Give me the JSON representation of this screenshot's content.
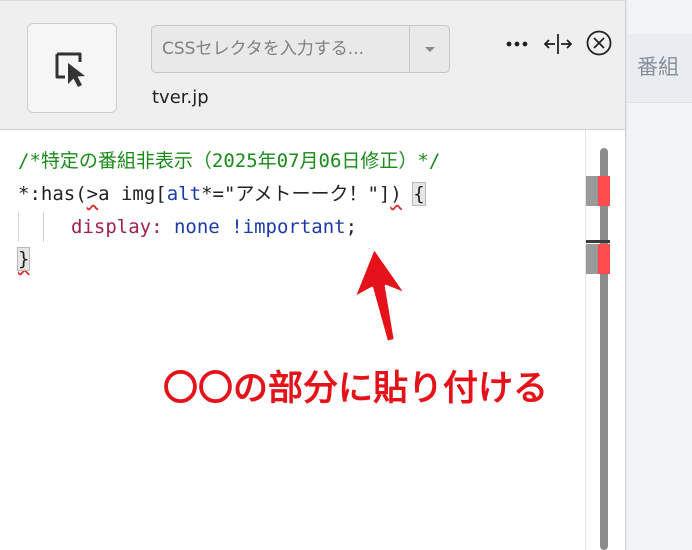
{
  "toolbar": {
    "selector_placeholder": "CSSセレクタを入力する...",
    "host": "tver.jp",
    "icons": {
      "picker": "element-picker-icon",
      "dropdown": "chevron-down-icon",
      "more": "more-dots-icon",
      "resize": "resize-horizontal-icon",
      "close": "close-circle-icon"
    }
  },
  "background_page": {
    "tab_label": "番組"
  },
  "editor": {
    "line1": "/*特定の番組非表示（2025年07月06日修正）*/",
    "line2": {
      "sel_start": "*:has(",
      "combinator": ">",
      "sel_mid": "a img[",
      "attr": "alt",
      "op": "*=",
      "str": "\"アメトーーク！\"",
      "close_bracket": "]",
      "close_paren": ")",
      "space": " ",
      "brace": "{"
    },
    "line3": {
      "prop": "display",
      "colon": ": ",
      "val": "none",
      "space": " ",
      "imp": "!important",
      "semi": ";"
    },
    "line4": "}"
  },
  "annotation": {
    "text": "〇〇の部分に貼り付ける",
    "color": "#e5121a"
  },
  "colors": {
    "comment": "#1b8a1b",
    "property": "#a0224a",
    "keyword": "#1a3aa8",
    "error": "#d63030",
    "ruler_error": "#ff4d4d"
  }
}
